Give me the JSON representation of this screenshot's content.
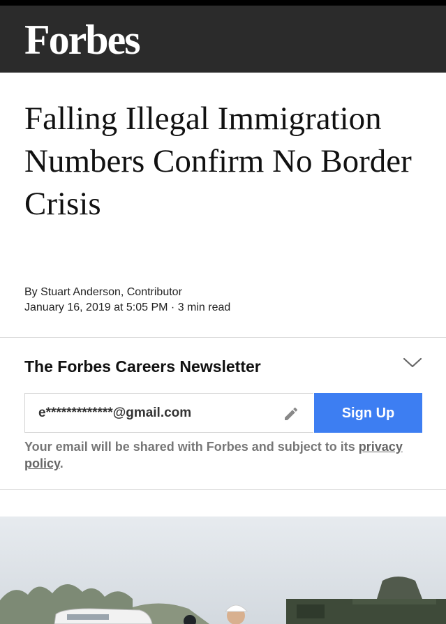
{
  "header": {
    "logo": "Forbes"
  },
  "article": {
    "headline": "Falling Illegal Immigration Numbers Confirm No Border Crisis",
    "byline": "By Stuart Anderson, Contributor",
    "date": "January 16, 2019 at 5:05 PM",
    "separator": "·",
    "read_time": "3 min read"
  },
  "newsletter": {
    "title": "The Forbes Careers Newsletter",
    "chevron_icon": "chevron-down-icon",
    "email_value": "e*************@gmail.com",
    "edit_icon": "pencil-icon",
    "signup_label": "Sign Up",
    "disclaimer_prefix": "Your email will be shared with Forbes and subject to its",
    "privacy_link": "privacy policy",
    "disclaimer_suffix": "."
  },
  "colors": {
    "header_bg": "#2b2b2b",
    "signup_bg": "#3d7ef2",
    "disclaimer_text": "#777777"
  }
}
